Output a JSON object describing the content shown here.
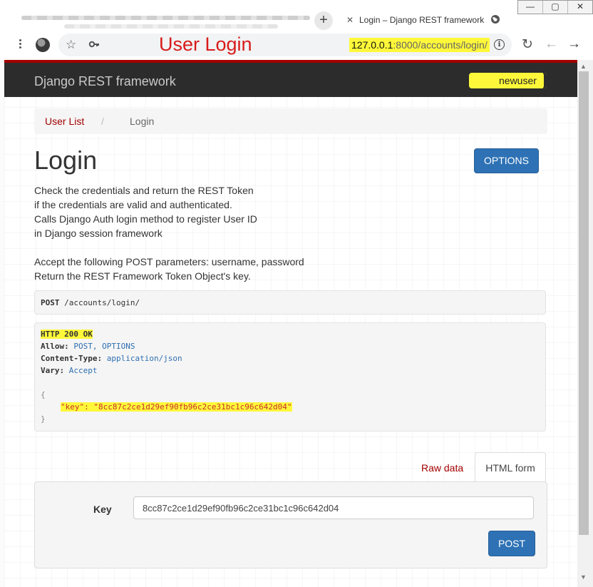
{
  "browser": {
    "tab_title": "Login – Django REST framework",
    "tab_close": "✕",
    "new_tab": "+",
    "window_controls": [
      "—",
      "▢",
      "✕"
    ],
    "url_host": "127.0.0.1",
    "url_rest": ":8000/accounts/login/",
    "annotation": "User Login",
    "icons": [
      "kebab-menu-icon",
      "avatar",
      "star-icon",
      "key-icon",
      "info-icon",
      "reload-icon",
      "back-icon",
      "forward-icon",
      "globe-icon"
    ]
  },
  "navbar": {
    "brand": "Django REST framework",
    "user": "newuser"
  },
  "breadcrumb": {
    "link": "User List",
    "separator": "/",
    "active": "Login"
  },
  "page": {
    "title": "Login",
    "options_label": "OPTIONS",
    "description": [
      "Check the credentials and return the REST Token",
      "if the credentials are valid and authenticated.",
      "Calls Django Auth login method to register User ID",
      "in Django session framework",
      "Accept the following POST parameters: username, password",
      "Return the REST Framework Token Object's key."
    ]
  },
  "request": {
    "method": "POST",
    "path": " /accounts/login/"
  },
  "response": {
    "status": "HTTP 200 OK",
    "allow_label": "Allow:",
    "allow_value": " POST, OPTIONS",
    "content_type_label": "Content-Type:",
    "content_type_value": " application/json",
    "vary_label": "Vary:",
    "vary_value": " Accept",
    "open_brace": "{",
    "body_line": "\"key\": \"8cc87c2ce1d29ef90fb96c2ce31bc1c96c642d04\"",
    "close_brace": "}"
  },
  "tabs": {
    "raw": "Raw data",
    "html": "HTML form"
  },
  "form": {
    "key_label": "Key",
    "key_value": "8cc87c2ce1d29ef90fb96c2ce31bc1c96c642d04",
    "post_label": "POST"
  },
  "colors": {
    "accent_red": "#a30000",
    "navbar": "#2c2c2c",
    "button_blue": "#2e72b5",
    "highlight": "#fff83a",
    "annotation_red": "#d81b1b"
  }
}
